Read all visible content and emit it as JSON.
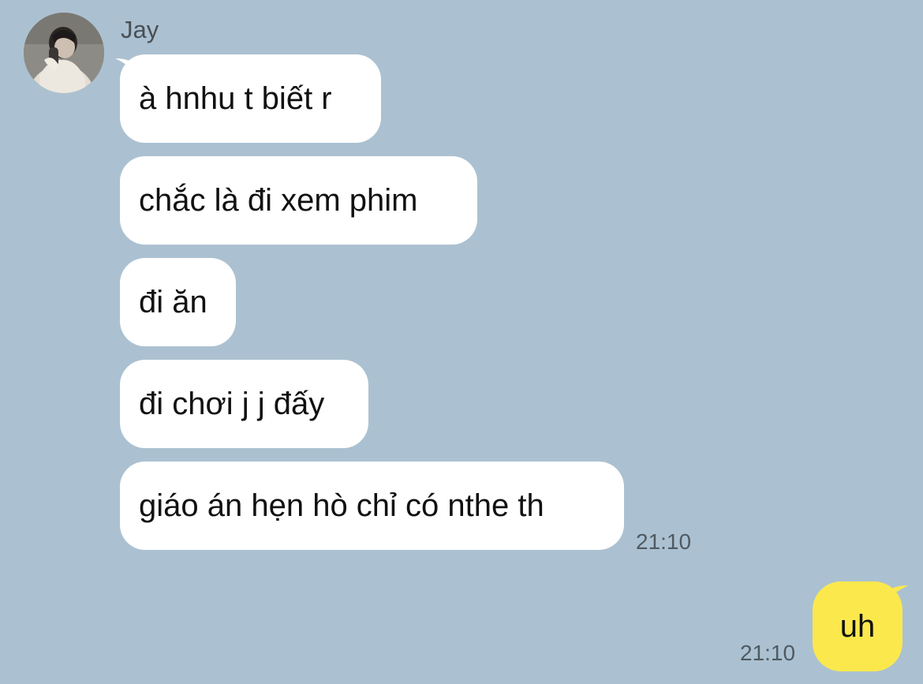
{
  "chat": {
    "incoming": {
      "sender": "Jay",
      "avatar_icon": "profile-photo",
      "messages": [
        "à hnhu t biết r",
        "chắc là đi xem phim",
        "đi ăn",
        "đi chơi j j đấy",
        "giáo án hẹn hò chỉ có nthe th"
      ],
      "time": "21:10",
      "bubble_color": "#ffffff"
    },
    "outgoing": {
      "message": "uh",
      "time": "21:10",
      "bubble_color": "#fae84d"
    },
    "background_color": "#abc1d1"
  }
}
